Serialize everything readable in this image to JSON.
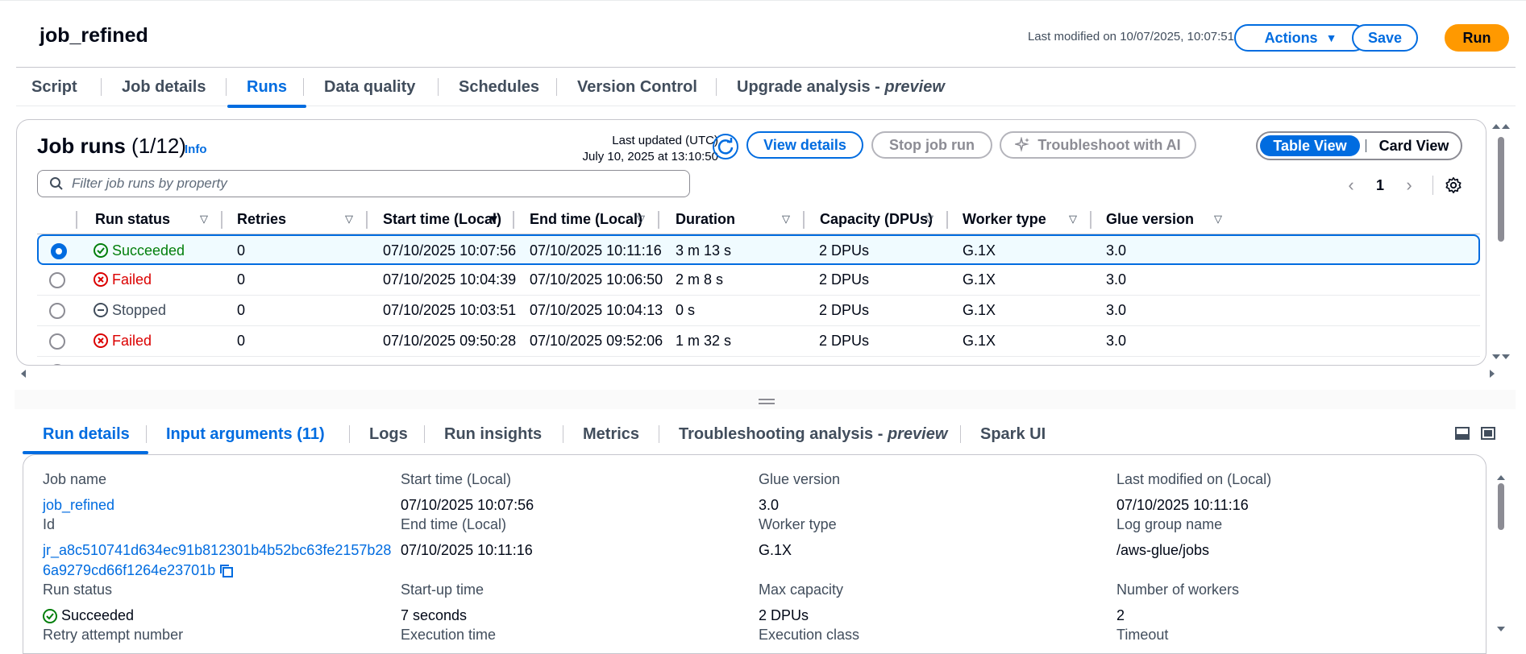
{
  "header": {
    "job_title": "job_refined",
    "last_modified": "Last modified on 10/07/2025, 10:07:51",
    "actions_label": "Actions",
    "save_label": "Save",
    "run_label": "Run"
  },
  "top_tabs": [
    {
      "label": "Script"
    },
    {
      "label": "Job details"
    },
    {
      "label": "Runs",
      "active": true
    },
    {
      "label": "Data quality"
    },
    {
      "label": "Schedules"
    },
    {
      "label": "Version Control"
    },
    {
      "label": "Upgrade analysis - ",
      "italic": "preview"
    }
  ],
  "runs_panel": {
    "title": "Job runs",
    "count": "(1/12)",
    "info": "Info",
    "last_updated_label": "Last updated (UTC)",
    "last_updated_value": "July 10, 2025 at 13:10:50",
    "view_details": "View details",
    "stop_job_run": "Stop job run",
    "troubleshoot_ai": "Troubleshoot with AI",
    "table_view": "Table View",
    "card_view": "Card View",
    "filter_placeholder": "Filter job runs by property",
    "page": "1",
    "columns": [
      "Run status",
      "Retries",
      "Start time (Local)",
      "End time (Local)",
      "Duration",
      "Capacity (DPUs)",
      "Worker type",
      "Glue version"
    ],
    "rows": [
      {
        "status": "Succeeded",
        "kind": "ok",
        "retries": "0",
        "start": "07/10/2025 10:07:56",
        "end": "07/10/2025 10:11:16",
        "duration": "3 m 13 s",
        "capacity": "2 DPUs",
        "worker": "G.1X",
        "glue": "3.0",
        "selected": true
      },
      {
        "status": "Failed",
        "kind": "fail",
        "retries": "0",
        "start": "07/10/2025 10:04:39",
        "end": "07/10/2025 10:06:50",
        "duration": "2 m 8 s",
        "capacity": "2 DPUs",
        "worker": "G.1X",
        "glue": "3.0"
      },
      {
        "status": "Stopped",
        "kind": "stop",
        "retries": "0",
        "start": "07/10/2025 10:03:51",
        "end": "07/10/2025 10:04:13",
        "duration": "0 s",
        "capacity": "2 DPUs",
        "worker": "G.1X",
        "glue": "3.0"
      },
      {
        "status": "Failed",
        "kind": "fail",
        "retries": "0",
        "start": "07/10/2025 09:50:28",
        "end": "07/10/2025 09:52:06",
        "duration": "1 m 32 s",
        "capacity": "2 DPUs",
        "worker": "G.1X",
        "glue": "3.0"
      }
    ]
  },
  "lower_tabs": [
    {
      "label": "Run details",
      "active": true
    },
    {
      "label": "Input arguments (11)",
      "blue": true
    },
    {
      "label": "Logs"
    },
    {
      "label": "Run insights"
    },
    {
      "label": "Metrics"
    },
    {
      "label": "Troubleshooting analysis - ",
      "italic": "preview"
    },
    {
      "label": "Spark UI"
    }
  ],
  "details": {
    "job_name_label": "Job name",
    "job_name": "job_refined",
    "id_label": "Id",
    "id_line1": "jr_a8c510741d634ec91b812301b4b52bc63fe2157b28",
    "id_line2": "6a9279cd66f1264e23701b",
    "run_status_label": "Run status",
    "run_status": "Succeeded",
    "retry_label": "Retry attempt number",
    "start_label": "Start time (Local)",
    "start": "07/10/2025 10:07:56",
    "end_label": "End time (Local)",
    "end": "07/10/2025 10:11:16",
    "startup_label": "Start-up time",
    "startup": "7 seconds",
    "exec_time_label": "Execution time",
    "glue_label": "Glue version",
    "glue": "3.0",
    "worker_label": "Worker type",
    "worker": "G.1X",
    "maxcap_label": "Max capacity",
    "maxcap": "2 DPUs",
    "exec_class_label": "Execution class",
    "lastmod_label": "Last modified on (Local)",
    "lastmod": "07/10/2025 10:11:16",
    "loggroup_label": "Log group name",
    "loggroup": "/aws-glue/jobs",
    "workers_label": "Number of workers",
    "workers": "2",
    "timeout_label": "Timeout"
  },
  "colors": {
    "accent": "#006ce0",
    "success": "#037f0c",
    "error": "#db0000",
    "run_button": "#ff9900"
  }
}
